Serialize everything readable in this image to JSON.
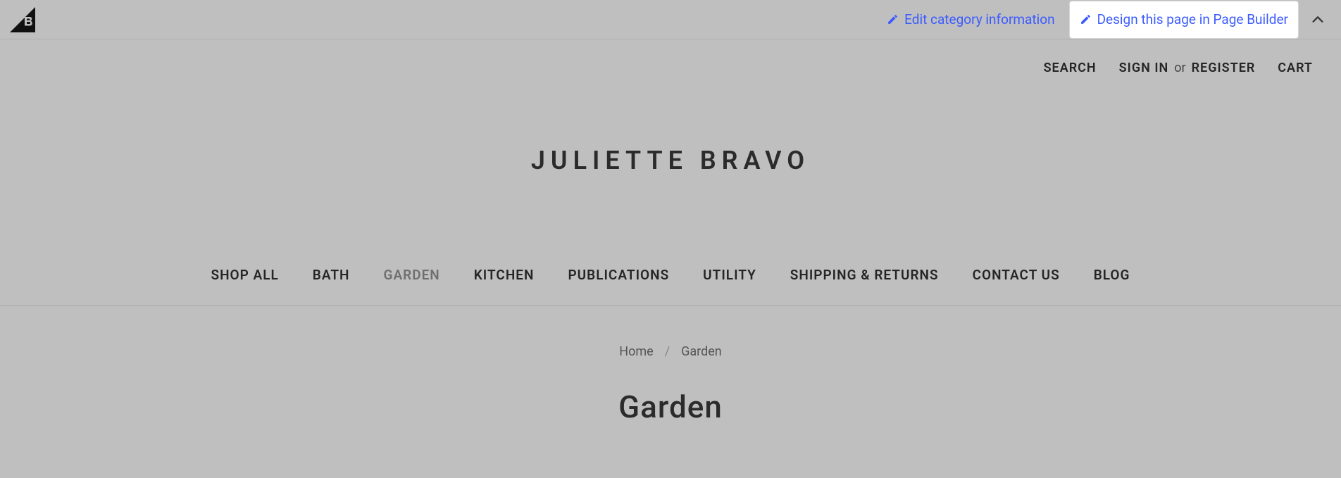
{
  "adminBar": {
    "editCategory": "Edit category information",
    "designPage": "Design this page in Page Builder"
  },
  "userBar": {
    "search": "SEARCH",
    "signIn": "SIGN IN",
    "or": "or",
    "register": "REGISTER",
    "cart": "CART"
  },
  "siteTitle": "JULIETTE BRAVO",
  "nav": {
    "items": [
      {
        "label": "SHOP ALL",
        "active": false
      },
      {
        "label": "BATH",
        "active": false
      },
      {
        "label": "GARDEN",
        "active": true
      },
      {
        "label": "KITCHEN",
        "active": false
      },
      {
        "label": "PUBLICATIONS",
        "active": false
      },
      {
        "label": "UTILITY",
        "active": false
      },
      {
        "label": "SHIPPING & RETURNS",
        "active": false
      },
      {
        "label": "CONTACT US",
        "active": false
      },
      {
        "label": "BLOG",
        "active": false
      }
    ]
  },
  "breadcrumb": {
    "home": "Home",
    "sep": "/",
    "current": "Garden"
  },
  "pageHeading": "Garden"
}
